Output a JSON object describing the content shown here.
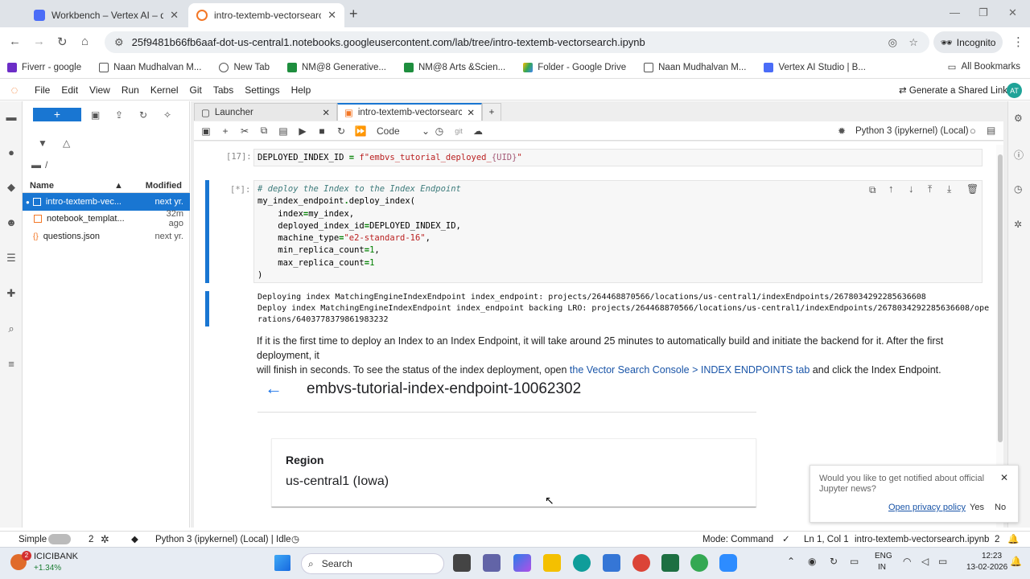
{
  "browser": {
    "tabs": [
      {
        "title": "Workbench – Vertex AI – qwikla"
      },
      {
        "title": "intro-textemb-vectorsearch.ipyn"
      }
    ],
    "url": "25f9481b66fb6aaf-dot-us-central1.notebooks.googleusercontent.com/lab/tree/intro-textemb-vectorsearch.ipynb",
    "incognito_label": "Incognito",
    "bookmarks": [
      "Fiverr - google",
      "Naan Mudhalvan M...",
      "New Tab",
      "NM@8 Generative...",
      "NM@8 Arts &Scien...",
      "Folder - Google Drive",
      "Naan Mudhalvan M...",
      "Vertex AI Studio | B..."
    ],
    "all_bookmarks": "All Bookmarks"
  },
  "jupyter": {
    "menu": [
      "File",
      "Edit",
      "View",
      "Run",
      "Kernel",
      "Git",
      "Tabs",
      "Settings",
      "Help"
    ],
    "share_label": "Generate a Shared Link",
    "avatar": "AT",
    "files": {
      "path": "/",
      "col_name": "Name",
      "col_modified": "Modified",
      "rows": [
        {
          "name": "intro-textemb-vec...",
          "modified": "next yr."
        },
        {
          "name": "notebook_templat...",
          "modified": "32m ago"
        },
        {
          "name": "questions.json",
          "modified": "next yr."
        }
      ]
    },
    "doc_tabs": [
      "Launcher",
      "intro-textemb-vectorsearch.ip"
    ],
    "cell_type": "Code",
    "kernel": "Python 3 (ipykernel) (Local)",
    "cells": {
      "prompt1": "[17]:",
      "prompt2": "[*]:",
      "output1": "Deploying index MatchingEngineIndexEndpoint index_endpoint: projects/264468870566/locations/us-central1/indexEndpoints/2678034292285636608",
      "output2": "Deploy index MatchingEngineIndexEndpoint index_endpoint backing LRO: projects/264468870566/locations/us-central1/indexEndpoints/2678034292285636608/ope",
      "output3": "rations/6403778379861983232",
      "md_text1": "If it is the first time to deploy an Index to an Index Endpoint, it will take around 25 minutes to automatically build and initiate the backend for it. After the first deployment, it",
      "md_text2a": "will finish in seconds. To see the status of the index deployment, open ",
      "md_link": "the Vector Search Console > INDEX ENDPOINTS tab",
      "md_text2b": " and click the Index Endpoint.",
      "image_title": "embvs-tutorial-index-endpoint-10062302",
      "region_label": "Region",
      "region_value": "us-central1 (Iowa)"
    },
    "popup": {
      "text": "Would you like to get notified about official Jupyter news?",
      "privacy": "Open privacy policy",
      "yes": "Yes",
      "no": "No"
    },
    "status": {
      "mode": "Simple",
      "count1": "2",
      "kernel_status": "Python 3 (ipykernel) (Local) | Idle",
      "cmd_mode": "Mode: Command",
      "cursor": "Ln 1, Col 1",
      "file": "intro-textemb-vectorsearch.ipynb",
      "count2": "2"
    }
  },
  "taskbar": {
    "stock_name": "ICICIBANK",
    "stock_change": "+1.34%",
    "search": "Search",
    "lang1": "ENG",
    "lang2": "IN",
    "time": "12:23",
    "date": "13-02-2026",
    "badge": "2"
  },
  "colors": {
    "accent": "#1976d2",
    "jupyter_orange": "#f37726"
  }
}
